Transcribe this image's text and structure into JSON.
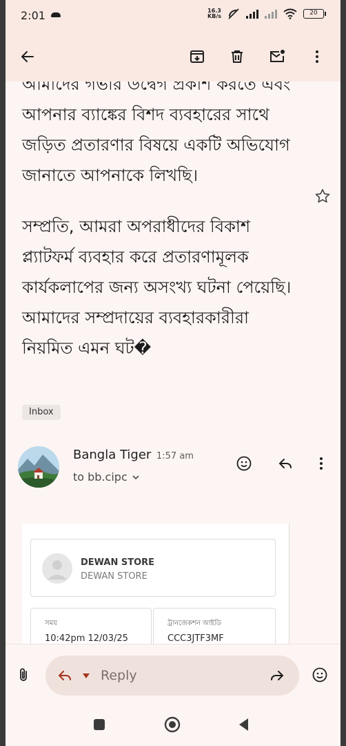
{
  "status_bar": {
    "time": "2:01",
    "net_speed_value": "16.3",
    "net_speed_unit": "KB/s",
    "battery": "20"
  },
  "toolbar": {
    "back_icon": "arrow-back-icon",
    "archive_icon": "archive-icon",
    "delete_icon": "trash-icon",
    "mark_unread_icon": "mail-unread-icon",
    "more_icon": "more-vert-icon"
  },
  "message": {
    "paragraph_1": "আমাদের গভীর উদ্বেগ প্রকাশ করতে এবং আপনার ব্যাঙ্কের বিশদ ব্যবহারের সাথে জড়িত প্রতারণার বিষয়ে একটি অভিযোগ জানাতে আপনাকে লিখছি।",
    "paragraph_2": "সম্প্রতি, আমরা অপরাধীদের বিকাশ প্ল্যাটফর্ম ব্যবহার করে প্রতারণামূলক কার্যকলাপের জন্য অসংখ্য ঘটনা পেয়েছি। আমাদের সম্প্রদায়ের ব্যবহারকারীরা নিয়মিত এমন ঘট�",
    "label": "Inbox"
  },
  "sender": {
    "name": "Bangla Tiger",
    "time": "1:57 am",
    "to": "to bb.cipc"
  },
  "receipt": {
    "store_name": "DEWAN STORE",
    "store_subtitle": "DEWAN STORE",
    "time_label": "সময়",
    "time_value": "10:42pm 12/03/25",
    "txn_label": "ট্রানজেকশন আইডি",
    "txn_value": "CCC3JTF3MF"
  },
  "reply_bar": {
    "placeholder": "Reply"
  },
  "colors": {
    "header_bg": "#fae9e3",
    "page_bg": "#fdf5f3",
    "pill_bg": "#efe2dd"
  }
}
